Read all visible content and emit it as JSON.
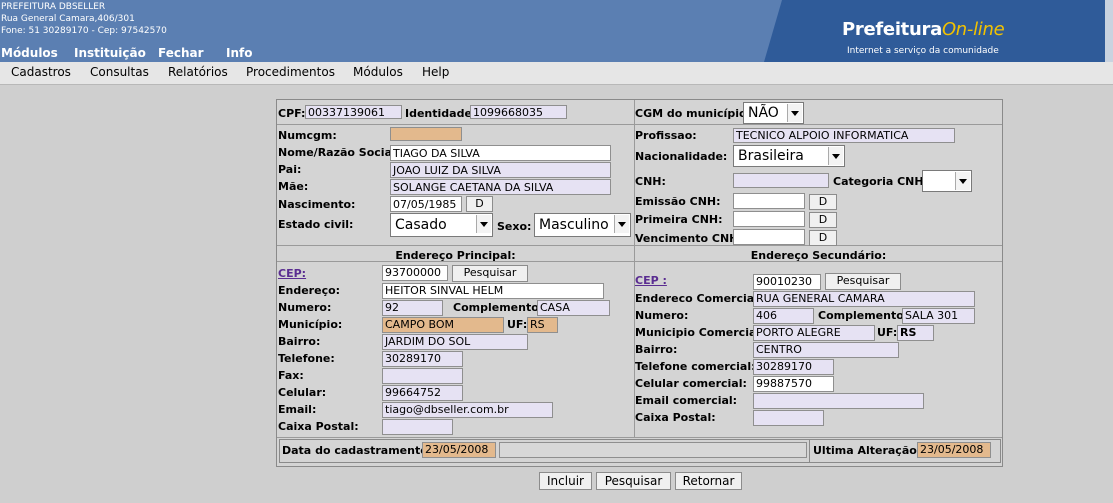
{
  "header": {
    "org_name": "PREFEITURA DBSELLER",
    "address": "Rua General Camara,406/301",
    "contact": "Fone: 51 30289170  -  Cep: 97542570",
    "brand_main": "Prefeitura",
    "brand_online": "On-line",
    "brand_tagline": "Internet a serviço da comunidade"
  },
  "top_menu": [
    "Módulos",
    "Instituição",
    "Fechar",
    "Info"
  ],
  "menubar": [
    "Cadastros",
    "Consultas",
    "Relatórios",
    "Procedimentos",
    "Módulos",
    "Help"
  ],
  "form": {
    "cpf_label": "CPF:",
    "cpf": "00337139061",
    "identidade_label": "Identidade:",
    "identidade": "1099668035",
    "cgm_label": "CGM do município:",
    "cgm": "NÃO",
    "numcgm_label": "Numcgm:",
    "numcgm": "",
    "nome_label": "Nome/Razão Social:",
    "nome": "TIAGO DA SILVA",
    "pai_label": "Pai:",
    "pai": "JOAO LUIZ DA SILVA",
    "mae_label": "Mãe:",
    "mae": "SOLANGE CAETANA DA SILVA",
    "nascimento_label": "Nascimento:",
    "nascimento": "07/05/1985",
    "date_btn": "D",
    "estado_civil_label": "Estado civil:",
    "estado_civil": "Casado",
    "sexo_label": "Sexo:",
    "sexo": "Masculino",
    "profissao_label": "Profissao:",
    "profissao": "TECNICO ALPOIO INFORMATICA",
    "nacionalidade_label": "Nacionalidade:",
    "nacionalidade": "Brasileira",
    "cnh_label": "CNH:",
    "cnh": "",
    "categoria_cnh_label": "Categoria CNH:",
    "categoria_cnh": "",
    "emissao_cnh_label": "Emissão CNH:",
    "emissao_cnh": "",
    "primeira_cnh_label": "Primeira CNH:",
    "primeira_cnh": "",
    "vencimento_cnh_label": "Vencimento CNH:",
    "vencimento_cnh": ""
  },
  "endereco_principal": {
    "title": "Endereço Principal:",
    "cep_label": "CEP:",
    "cep": "93700000",
    "pesquisar": "Pesquisar",
    "endereco_label": "Endereço:",
    "endereco": "HEITOR SINVAL HELM",
    "numero_label": "Numero:",
    "numero": "92",
    "complemento_label": "Complemento:",
    "complemento": "CASA",
    "municipio_label": "Município:",
    "municipio": "CAMPO BOM",
    "uf_label": "UF:",
    "uf": "RS",
    "bairro_label": "Bairro:",
    "bairro": "JARDIM DO SOL",
    "telefone_label": "Telefone:",
    "telefone": "30289170",
    "fax_label": "Fax:",
    "fax": "",
    "celular_label": "Celular:",
    "celular": "99664752",
    "email_label": "Email:",
    "email": "tiago@dbseller.com.br",
    "caixa_postal_label": "Caixa Postal:",
    "caixa_postal": ""
  },
  "endereco_secundario": {
    "title": "Endereço Secundário:",
    "cep_label": "CEP :",
    "cep": "90010230",
    "pesquisar": "Pesquisar",
    "endereco_label": "Endereco Comercial:",
    "endereco": "RUA GENERAL CAMARA",
    "numero_label": "Numero:",
    "numero": "406",
    "complemento_label": "Complemento:",
    "complemento": "SALA 301",
    "municipio_label": "Municipio Comercial:",
    "municipio": "PORTO ALEGRE",
    "uf_label": "UF:",
    "uf": "RS",
    "bairro_label": "Bairro:",
    "bairro": "CENTRO",
    "telefone_label": "Telefone comercial:",
    "telefone": "30289170",
    "celular_label": "Celular comercial:",
    "celular": "99887570",
    "email_label": "Email comercial:",
    "email": "",
    "caixa_postal_label": "Caixa Postal:",
    "caixa_postal": ""
  },
  "footer": {
    "data_cad_label": "Data do cadastramento:",
    "data_cad": "23/05/2008",
    "ultima_label": "Ultima Alteração :",
    "ultima": "23/05/2008"
  },
  "actions": {
    "incluir": "Incluir",
    "pesquisar": "Pesquisar",
    "retornar": "Retornar"
  }
}
